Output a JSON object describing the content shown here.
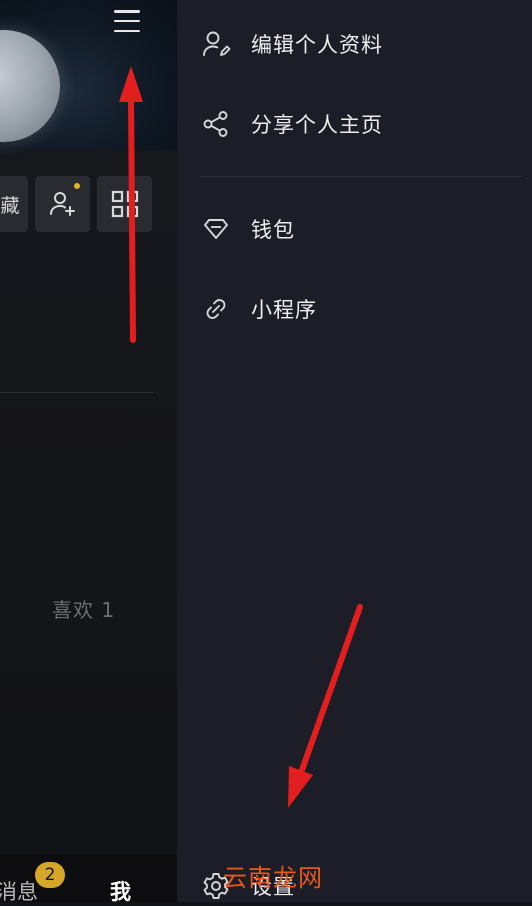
{
  "left": {
    "favorites_partial": "藏",
    "likes_label": "喜欢 1",
    "bottom_nav": {
      "messages_partial": "消息",
      "messages_badge": "2",
      "me": "我"
    }
  },
  "drawer": {
    "items": [
      {
        "label": "编辑个人资料",
        "icon": "edit-profile-icon"
      },
      {
        "label": "分享个人主页",
        "icon": "share-icon"
      },
      {
        "label": "钱包",
        "icon": "diamond-icon"
      },
      {
        "label": "小程序",
        "icon": "link-icon"
      },
      {
        "label": "设置",
        "icon": "gear-icon"
      }
    ]
  },
  "watermark": "云南龙网",
  "colors": {
    "drawer_bg": "#1c1d26",
    "badge": "#d6a629",
    "arrow": "#e31e1e",
    "watermark": "#e7581b"
  }
}
